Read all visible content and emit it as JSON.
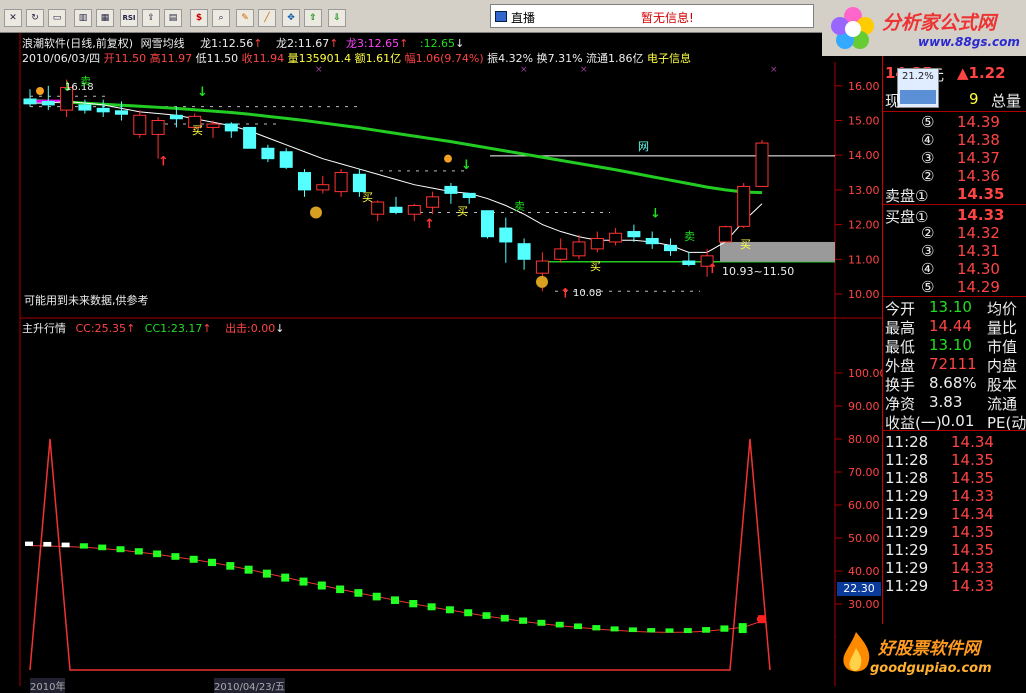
{
  "toolbar": {
    "icons": [
      "close-icon",
      "refresh-icon",
      "window-icon",
      "bar-chart-icon",
      "rsi-icon",
      "export-icon",
      "grid-icon",
      "dollar-icon",
      "zoom-icon",
      "pen-icon",
      "move-icon",
      "arrow-up-icon",
      "arrow-down-icon"
    ],
    "rsi_label": "RSI"
  },
  "live_box": {
    "label": "直播",
    "message": "暂无信息!"
  },
  "logo_top": {
    "title": "分析家公式网",
    "url": "www.88gs.com"
  },
  "main_header": {
    "line1": {
      "name": "浪潮软件(日线,前复权)",
      "indicator": "网雪均线",
      "long1": "龙1:12.56",
      "long2": "龙2:11.67",
      "long3": "龙3:12.65",
      "long4": ":12.65"
    },
    "line2": {
      "date": "2010/06/03/四",
      "open": "开11.50",
      "high": "高11.97",
      "low": "低11.50",
      "close": "收11.94",
      "vol": "量135901.4",
      "amt": "额1.61亿",
      "chg": "幅1.06(9.74%)",
      "amp": "振4.32%",
      "turn": "换7.31%",
      "float": "流通1.86亿",
      "info": "电子信息"
    }
  },
  "main_chart": {
    "y_ticks": [
      "16.00",
      "15.00",
      "14.00",
      "13.00",
      "12.00",
      "11.00",
      "10.00"
    ],
    "annotations": {
      "high_label": "16.18",
      "low_label": "10.08",
      "range_label": "10.93~11.50",
      "net_label": "网",
      "buy": "买",
      "sell": "卖",
      "note": "可能用到未来数据,供参考"
    }
  },
  "sub_header": {
    "name": "主升行情",
    "cc": "CC:25.35",
    "cc1": "CC1:23.17",
    "out": "出击:0.00"
  },
  "sub_chart": {
    "y_ticks": [
      "100.00",
      "90.00",
      "80.00",
      "70.00",
      "60.00",
      "50.00",
      "40.00",
      "30.00",
      "20.00"
    ],
    "cursor_value": "22.30"
  },
  "right_panel": {
    "price": "14.35",
    "unit": "元",
    "change": "▲1.22",
    "mini_chart_pct": "21.2%",
    "now_label": "现",
    "now_value": "9",
    "total_label": "总量",
    "sell_rows": [
      {
        "label": "⑤",
        "value": "14.39"
      },
      {
        "label": "④",
        "value": "14.38"
      },
      {
        "label": "③",
        "value": "14.37"
      },
      {
        "label": "②",
        "value": "14.36"
      },
      {
        "label": "卖盘①",
        "value": "14.35"
      }
    ],
    "buy_rows": [
      {
        "label": "买盘①",
        "value": "14.33"
      },
      {
        "label": "②",
        "value": "14.32"
      },
      {
        "label": "③",
        "value": "14.31"
      },
      {
        "label": "④",
        "value": "14.30"
      },
      {
        "label": "⑤",
        "value": "14.29"
      }
    ],
    "stats": [
      {
        "label": "今开",
        "value": "13.10",
        "label2": "均价"
      },
      {
        "label": "最高",
        "value": "14.44",
        "label2": "量比"
      },
      {
        "label": "最低",
        "value": "13.10",
        "label2": "市值"
      },
      {
        "label": "外盘",
        "value": "72111",
        "label2": "内盘"
      },
      {
        "label": "换手",
        "value": "8.68%",
        "label2": "股本"
      },
      {
        "label": "净资",
        "value": "3.83",
        "label2": "流通"
      },
      {
        "label": "收益(一)",
        "value": "0.01",
        "label2": "PE(动"
      }
    ],
    "ticks": [
      {
        "time": "11:28",
        "price": "14.34"
      },
      {
        "time": "11:28",
        "price": "14.35"
      },
      {
        "time": "11:28",
        "price": "14.35"
      },
      {
        "time": "11:29",
        "price": "14.33"
      },
      {
        "time": "11:29",
        "price": "14.34"
      },
      {
        "time": "11:29",
        "price": "14.35"
      },
      {
        "time": "11:29",
        "price": "14.35"
      },
      {
        "time": "11:29",
        "price": "14.33"
      },
      {
        "time": "11:29",
        "price": "14.33"
      }
    ]
  },
  "logo_bottom": {
    "title": "好股票软件网",
    "url": "goodgupiao.com"
  },
  "footer": {
    "date_left": "2010年",
    "date_mid": "2010/04/23/五"
  },
  "candles": [
    {
      "o": 15.62,
      "h": 15.9,
      "l": 15.4,
      "c": 15.48
    },
    {
      "o": 15.55,
      "h": 16.0,
      "l": 15.3,
      "c": 15.45
    },
    {
      "o": 15.3,
      "h": 16.18,
      "l": 15.1,
      "c": 15.95
    },
    {
      "o": 15.45,
      "h": 15.6,
      "l": 15.2,
      "c": 15.3
    },
    {
      "o": 15.35,
      "h": 15.6,
      "l": 15.1,
      "c": 15.25
    },
    {
      "o": 15.28,
      "h": 15.55,
      "l": 15.0,
      "c": 15.18
    },
    {
      "o": 14.6,
      "h": 15.3,
      "l": 14.5,
      "c": 15.15
    },
    {
      "o": 14.6,
      "h": 15.1,
      "l": 13.9,
      "c": 15.0
    },
    {
      "o": 15.15,
      "h": 15.4,
      "l": 14.8,
      "c": 15.05
    },
    {
      "o": 14.8,
      "h": 15.2,
      "l": 14.7,
      "c": 15.12
    },
    {
      "o": 14.8,
      "h": 15.0,
      "l": 14.5,
      "c": 14.9
    },
    {
      "o": 14.9,
      "h": 14.95,
      "l": 14.5,
      "c": 14.7
    },
    {
      "o": 14.8,
      "h": 14.8,
      "l": 14.2,
      "c": 14.2
    },
    {
      "o": 14.2,
      "h": 14.3,
      "l": 13.8,
      "c": 13.9
    },
    {
      "o": 14.1,
      "h": 14.2,
      "l": 13.6,
      "c": 13.65
    },
    {
      "o": 13.5,
      "h": 13.6,
      "l": 12.8,
      "c": 13.0
    },
    {
      "o": 13.0,
      "h": 13.4,
      "l": 12.9,
      "c": 13.15
    },
    {
      "o": 12.95,
      "h": 13.6,
      "l": 12.8,
      "c": 13.5
    },
    {
      "o": 13.45,
      "h": 13.6,
      "l": 12.8,
      "c": 12.95
    },
    {
      "o": 12.3,
      "h": 12.7,
      "l": 12.1,
      "c": 12.65
    },
    {
      "o": 12.5,
      "h": 12.8,
      "l": 12.3,
      "c": 12.35
    },
    {
      "o": 12.3,
      "h": 12.6,
      "l": 12.1,
      "c": 12.55
    },
    {
      "o": 12.5,
      "h": 12.95,
      "l": 12.3,
      "c": 12.8
    },
    {
      "o": 13.1,
      "h": 13.2,
      "l": 12.6,
      "c": 12.9
    },
    {
      "o": 12.9,
      "h": 12.9,
      "l": 12.6,
      "c": 12.78
    },
    {
      "o": 12.4,
      "h": 12.4,
      "l": 11.6,
      "c": 11.65
    },
    {
      "o": 11.9,
      "h": 12.2,
      "l": 10.9,
      "c": 11.5
    },
    {
      "o": 11.45,
      "h": 11.6,
      "l": 10.7,
      "c": 11.0
    },
    {
      "o": 10.6,
      "h": 11.2,
      "l": 10.08,
      "c": 10.95
    },
    {
      "o": 11.0,
      "h": 11.6,
      "l": 10.9,
      "c": 11.3
    },
    {
      "o": 11.1,
      "h": 11.7,
      "l": 11.0,
      "c": 11.5
    },
    {
      "o": 11.3,
      "h": 11.8,
      "l": 11.2,
      "c": 11.6
    },
    {
      "o": 11.5,
      "h": 11.9,
      "l": 11.4,
      "c": 11.75
    },
    {
      "o": 11.8,
      "h": 12.0,
      "l": 11.5,
      "c": 11.65
    },
    {
      "o": 11.6,
      "h": 11.8,
      "l": 11.3,
      "c": 11.45
    },
    {
      "o": 11.4,
      "h": 11.6,
      "l": 11.1,
      "c": 11.25
    },
    {
      "o": 10.95,
      "h": 11.2,
      "l": 10.8,
      "c": 10.85
    },
    {
      "o": 10.8,
      "h": 11.3,
      "l": 10.5,
      "c": 11.1
    },
    {
      "o": 11.5,
      "h": 11.97,
      "l": 11.5,
      "c": 11.94
    },
    {
      "o": 11.95,
      "h": 13.2,
      "l": 11.9,
      "c": 13.1
    },
    {
      "o": 13.1,
      "h": 14.44,
      "l": 13.1,
      "c": 14.35
    }
  ],
  "sub_bars": [
    48.3,
    48.2,
    48.0,
    47.8,
    47.4,
    46.9,
    46.3,
    45.6,
    44.8,
    44.0,
    43.1,
    42.1,
    41.0,
    39.8,
    38.6,
    37.4,
    36.2,
    35.0,
    33.9,
    32.8,
    31.7,
    30.6,
    29.6,
    28.7,
    27.8,
    26.9,
    26.1,
    25.3,
    24.6,
    24.0,
    23.5,
    23.0,
    22.6,
    22.3,
    22.1,
    22.0,
    22.1,
    22.4,
    22.9,
    23.6,
    25.4
  ]
}
